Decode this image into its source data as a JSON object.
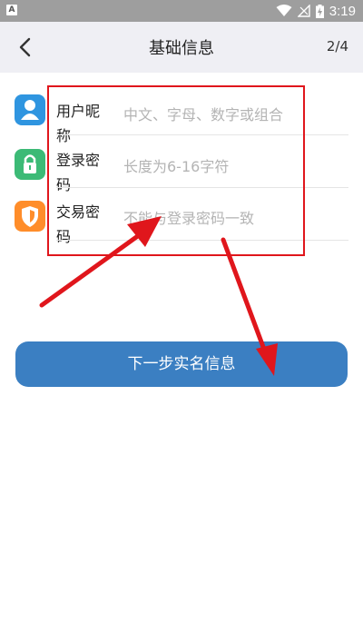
{
  "status_bar": {
    "time": "3:19",
    "left_icon": "A"
  },
  "header": {
    "title": "基础信息",
    "progress": "2/4"
  },
  "form": {
    "fields": [
      {
        "label": "用户昵称",
        "placeholder": "中文、字母、数字或组合",
        "icon": "user-icon",
        "color": "#2f95e0"
      },
      {
        "label": "登录密码",
        "placeholder": "长度为6-16字符",
        "icon": "lock-icon",
        "color": "#3cba76"
      },
      {
        "label": "交易密码",
        "placeholder": "不能与登录密码一致",
        "icon": "shield-icon",
        "color": "#ff8d2a"
      }
    ]
  },
  "next_button": {
    "label": "下一步实名信息"
  },
  "colors": {
    "accent": "#3b7fc2",
    "annotation": "#e0161c"
  }
}
